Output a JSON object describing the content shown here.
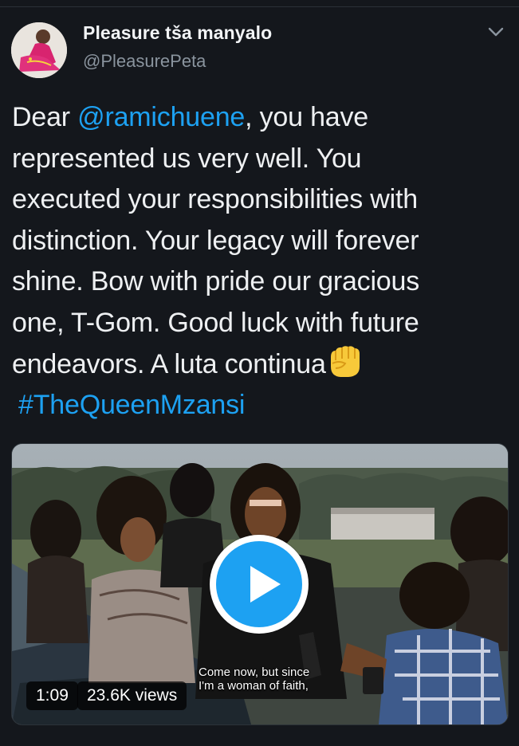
{
  "tweet": {
    "author": {
      "display_name": "Pleasure tša manyalo",
      "handle": "@PleasurePeta"
    },
    "menu_icon": "chevron-down-icon",
    "text": {
      "prefix": "Dear ",
      "mention": "@ramichuene",
      "line1_rest": ", you have",
      "line2": "represented us very well. You",
      "line3": "executed your responsibilities with",
      "line4": "distinction. Your legacy will forever",
      "line5": "shine. Bow with pride our gracious",
      "line6": "one, T-Gom. Good luck with future",
      "line7": "endeavors. A luta continua",
      "emoji": "raised-fist-icon",
      "hashtag": "#TheQueenMzansi"
    },
    "media": {
      "type": "video",
      "duration": "1:09",
      "views": "23.6K views",
      "subtitle_line1": "Come now, but since",
      "subtitle_line2": "I'm a woman of faith,"
    }
  },
  "colors": {
    "background": "#14171c",
    "link": "#1da1f2",
    "secondary_text": "#8a949e",
    "primary_text": "#eef0f2"
  }
}
